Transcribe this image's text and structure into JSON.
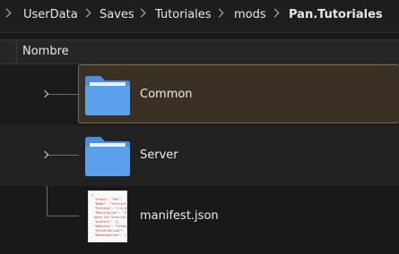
{
  "breadcrumb": {
    "items": [
      "UserData",
      "Saves",
      "Tutoriales",
      "mods",
      "Pan.Tutoriales"
    ]
  },
  "columns": {
    "name_header": "Nombre"
  },
  "files": [
    {
      "name": "Common",
      "type": "folder",
      "expandable": true,
      "selected": true,
      "icon": "folder-icon"
    },
    {
      "name": "Server",
      "type": "folder",
      "expandable": true,
      "selected": false,
      "icon": "folder-icon"
    },
    {
      "name": "manifest.json",
      "type": "json",
      "expandable": false,
      "selected": false,
      "icon": "json-file-icon"
    }
  ],
  "colors": {
    "folder": "#4a90e2",
    "selection_bg": "#3a3024",
    "selection_border": "#7d6a45"
  }
}
